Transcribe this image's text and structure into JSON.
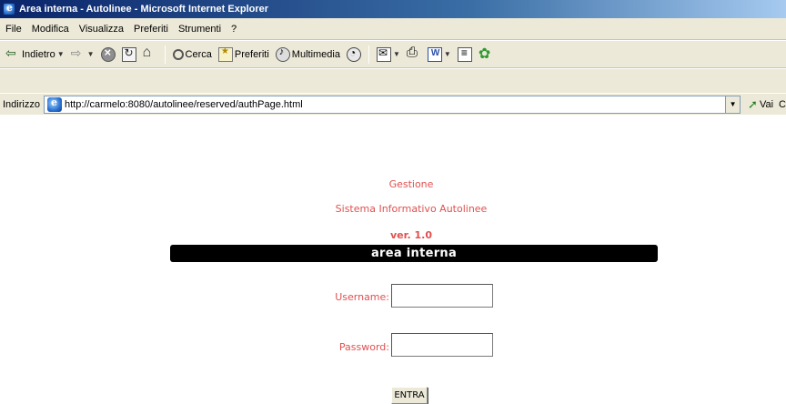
{
  "window": {
    "title": "Area interna - Autolinee - Microsoft Internet Explorer",
    "icon": "ie-icon"
  },
  "menubar": {
    "items": [
      "File",
      "Modifica",
      "Visualizza",
      "Preferiti",
      "Strumenti",
      "?"
    ]
  },
  "toolbar": {
    "back_label": "Indietro",
    "search_label": "Cerca",
    "favorites_label": "Preferiti",
    "media_label": "Multimedia"
  },
  "address": {
    "label": "Indirizzo",
    "url": "http://carmelo:8080/autolinee/reserved/authPage.html",
    "go_label": "Vai",
    "trailing": "C"
  },
  "page": {
    "heading1": "Gestione",
    "heading2": "Sistema Informativo Autolinee",
    "version": "ver. 1.0",
    "banner": "area interna",
    "accent_color": "#e05050",
    "username_label": "Username:",
    "username_value": "",
    "password_label": "Password:",
    "password_value": "",
    "submit_label": "ENTRA"
  }
}
